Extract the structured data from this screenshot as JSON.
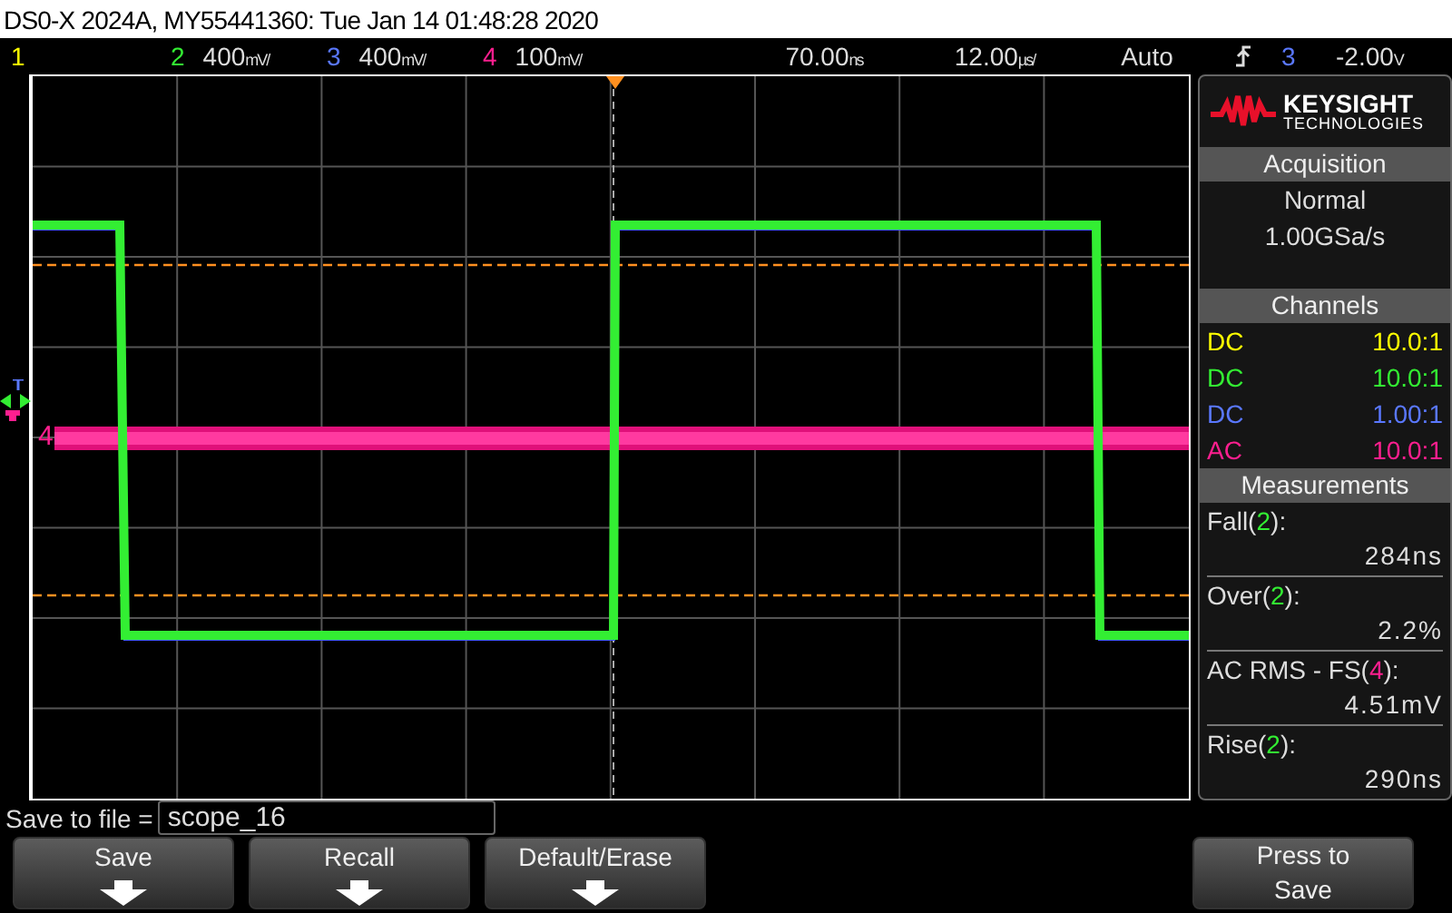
{
  "title_bar": {
    "text": "DS0-X 2024A, MY55441360: Tue Jan 14 01:48:28 2020"
  },
  "status_bar": {
    "channels": [
      {
        "number": "1",
        "color": "#ffff00"
      },
      {
        "number": "2",
        "scale": "400",
        "unit": "mV/",
        "color": "#33ee33"
      },
      {
        "number": "3",
        "scale": "400",
        "unit": "mV/",
        "color": "#5a78ff"
      },
      {
        "number": "4",
        "scale": "100",
        "unit": "mV/",
        "color": "#ff1f8f"
      }
    ],
    "delay": {
      "value": "70.00",
      "unit": "ns"
    },
    "timebase": {
      "value": "12.00",
      "unit": "µs/"
    },
    "trigger_mode": "Auto",
    "trigger_source": {
      "text": "3",
      "color": "#5a78ff"
    },
    "trigger_level": {
      "value": "-2.00",
      "unit": "V"
    }
  },
  "display": {
    "channel_label": {
      "text": "4",
      "color": "#ff1f8f"
    }
  },
  "sidebar": {
    "logo": {
      "name": "KEYSIGHT",
      "subtitle": "TECHNOLOGIES"
    },
    "acquisition": {
      "title": "Acquisition",
      "mode": "Normal",
      "rate": "1.00GSa/s"
    },
    "channels": {
      "title": "Channels",
      "rows": [
        {
          "coupling": "DC",
          "probe": "10.0:1",
          "color": "#ffff00"
        },
        {
          "coupling": "DC",
          "probe": "10.0:1",
          "color": "#33ee33"
        },
        {
          "coupling": "DC",
          "probe": "1.00:1",
          "color": "#5a78ff"
        },
        {
          "coupling": "AC",
          "probe": "10.0:1",
          "color": "#ff1f8f"
        }
      ]
    },
    "measurements": {
      "title": "Measurements",
      "items": [
        {
          "prefix": "Fall(",
          "source": "2",
          "suffix": "):",
          "value": "284ns",
          "color": "#33ee33"
        },
        {
          "prefix": "Over(",
          "source": "2",
          "suffix": "):",
          "value": "2.2%",
          "color": "#33ee33"
        },
        {
          "prefix": "AC RMS - FS(",
          "source": "4",
          "suffix": "):",
          "value": "4.51mV",
          "color": "#ff1f8f"
        },
        {
          "prefix": "Rise(",
          "source": "2",
          "suffix": "):",
          "value": "290ns",
          "color": "#33ee33"
        }
      ]
    }
  },
  "save_field": {
    "label": "Save to file =",
    "value": "scope_16"
  },
  "softkeys": [
    {
      "kind": "menu",
      "label": "Save"
    },
    {
      "kind": "menu",
      "label": "Recall"
    },
    {
      "kind": "menu",
      "label": "Default/Erase"
    },
    {
      "kind": "empty"
    },
    {
      "kind": "empty"
    },
    {
      "kind": "action",
      "label": "Press to Save"
    }
  ]
}
